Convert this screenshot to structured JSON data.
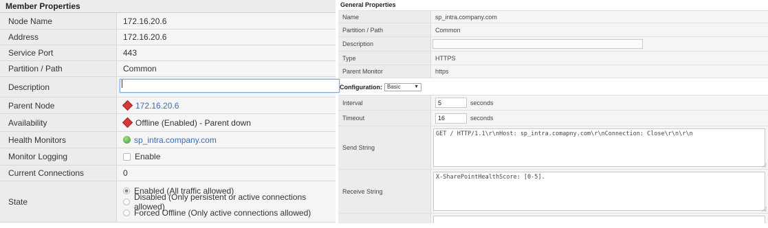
{
  "member_properties": {
    "title": "Member Properties",
    "node_name": {
      "label": "Node Name",
      "value": "172.16.20.6"
    },
    "address": {
      "label": "Address",
      "value": "172.16.20.6"
    },
    "service_port": {
      "label": "Service Port",
      "value": "443"
    },
    "partition": {
      "label": "Partition / Path",
      "value": "Common"
    },
    "description": {
      "label": "Description",
      "value": ""
    },
    "parent_node": {
      "label": "Parent Node",
      "value": "172.16.20.6"
    },
    "availability": {
      "label": "Availability",
      "value": "Offline (Enabled) - Parent down"
    },
    "health_monitors": {
      "label": "Health Monitors",
      "value": "sp_intra.company.com"
    },
    "monitor_logging": {
      "label": "Monitor Logging",
      "value": "Enable",
      "checked": false
    },
    "current_connections": {
      "label": "Current Connections",
      "value": "0"
    },
    "state": {
      "label": "State",
      "options": [
        "Enabled (All traffic allowed)",
        "Disabled (Only persistent or active connections allowed)",
        "Forced Offline (Only active connections allowed)"
      ],
      "selected": "Enabled (All traffic allowed)"
    }
  },
  "general_properties": {
    "title": "General Properties",
    "name": {
      "label": "Name",
      "value": "sp_intra.company.com"
    },
    "partition": {
      "label": "Partition / Path",
      "value": "Common"
    },
    "description": {
      "label": "Description",
      "value": ""
    },
    "type": {
      "label": "Type",
      "value": "HTTPS"
    },
    "parent_monitor": {
      "label": "Parent Monitor",
      "value": "https"
    }
  },
  "configuration": {
    "label": "Configuration:",
    "mode": "Basic",
    "interval": {
      "label": "Interval",
      "value": "5",
      "unit": "seconds"
    },
    "timeout": {
      "label": "Timeout",
      "value": "16",
      "unit": "seconds"
    },
    "send_string": {
      "label": "Send String",
      "value": "GET / HTTP/1.1\\r\\nHost: sp_intra.comapny.com\\r\\nConnection: Close\\r\\n\\r\\n"
    },
    "receive_string": {
      "label": "Receive String",
      "value": "X-SharePointHealthScore: [0-5]."
    }
  },
  "colors": {
    "label_bg": "#ececec",
    "value_bg": "#f5f5f5",
    "link": "#3a6bb3",
    "offline_red": "#d23a3a",
    "healthy_green": "#3c9b2a"
  }
}
